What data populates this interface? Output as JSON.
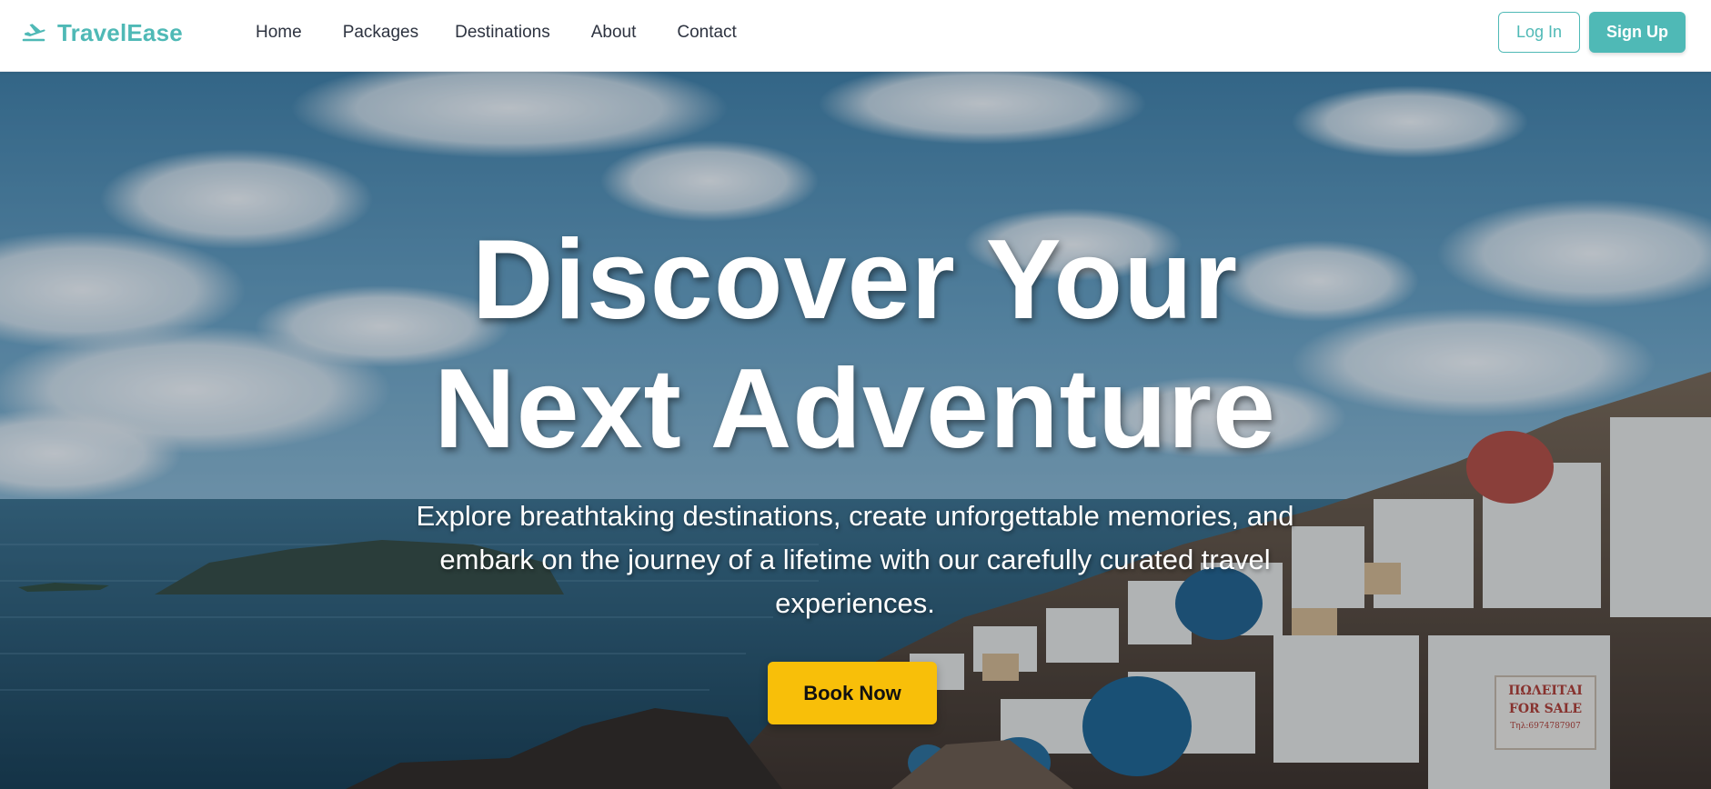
{
  "brand": {
    "name": "TravelEase",
    "icon": "airplane-takeoff-icon",
    "color": "#4fb9b6"
  },
  "nav": {
    "links": [
      "Home",
      "Packages",
      "Destinations",
      "About",
      "Contact"
    ]
  },
  "auth": {
    "login_label": "Log In",
    "signup_label": "Sign Up"
  },
  "hero": {
    "title_line1": "Discover Your",
    "title_line2": "Next Adventure",
    "subtitle": "Explore breathtaking destinations, create unforgettable memories, and embark on the journey of a lifetime with our carefully curated travel experiences.",
    "cta_label": "Book Now",
    "background": "santorini-coastline-photo",
    "sign_text_line1": "ΠΩΛΕΙΤΑΙ",
    "sign_text_line2": "FOR SALE",
    "sign_text_line3": "Τηλ:6974787907"
  },
  "colors": {
    "accent": "#4fb9b6",
    "cta": "#f8bf09",
    "nav_text": "#2d3340"
  }
}
